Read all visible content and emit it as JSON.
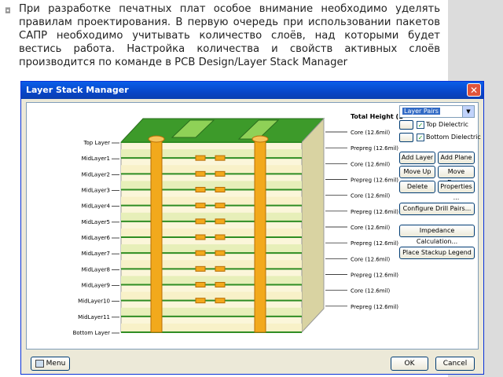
{
  "slide": {
    "bullet": "◘",
    "text": "При разработке печатных плат особое внимание необходимо уделять правилам проектирования. В первую очередь при использовании пакетов САПР необходимо учитывать количество слоёв, над которыми будет вестись работа. Настройка количества и свойств активных слоёв производится по команде в PCB Design/Layer Stack Manager"
  },
  "window": {
    "title": "Layer Stack Manager",
    "close": "✕"
  },
  "diagram": {
    "total_height": "Total Height (1",
    "left_labels": [
      "Top Layer",
      "MidLayer1",
      "MidLayer2",
      "MidLayer3",
      "MidLayer4",
      "MidLayer5",
      "MidLayer6",
      "MidLayer7",
      "MidLayer8",
      "MidLayer9",
      "MidLayer10",
      "MidLayer11",
      "Bottom Layer"
    ],
    "right_labels": [
      "Core (12.6mil)",
      "Prepreg (12.6mil)",
      "Core (12.6mil)",
      "Prepreg (12.6mil)",
      "Core (12.6mil)",
      "Prepreg (12.6mil)",
      "Core (12.6mil)",
      "Prepreg (12.6mil)",
      "Core (12.6mil)",
      "Prepreg (12.6mil)",
      "Core (12.6mil)",
      "Prepreg (12.6mil)"
    ]
  },
  "controls": {
    "layer_pairs": "Layer Pairs",
    "top_dielectric": "Top Dielectric",
    "bottom_dielectric": "Bottom Dielectric",
    "check_mark": "✓",
    "add_layer": "Add Layer",
    "add_plane": "Add Plane",
    "move_up": "Move Up",
    "move_down": "Move Down",
    "delete": "Delete",
    "properties": "Properties ...",
    "configure_drill": "Configure Drill Pairs...",
    "impedance": "Impedance Calculation...",
    "legend": "Place Stackup Legend"
  },
  "footer": {
    "menu": "Menu",
    "ok": "OK",
    "cancel": "Cancel"
  }
}
